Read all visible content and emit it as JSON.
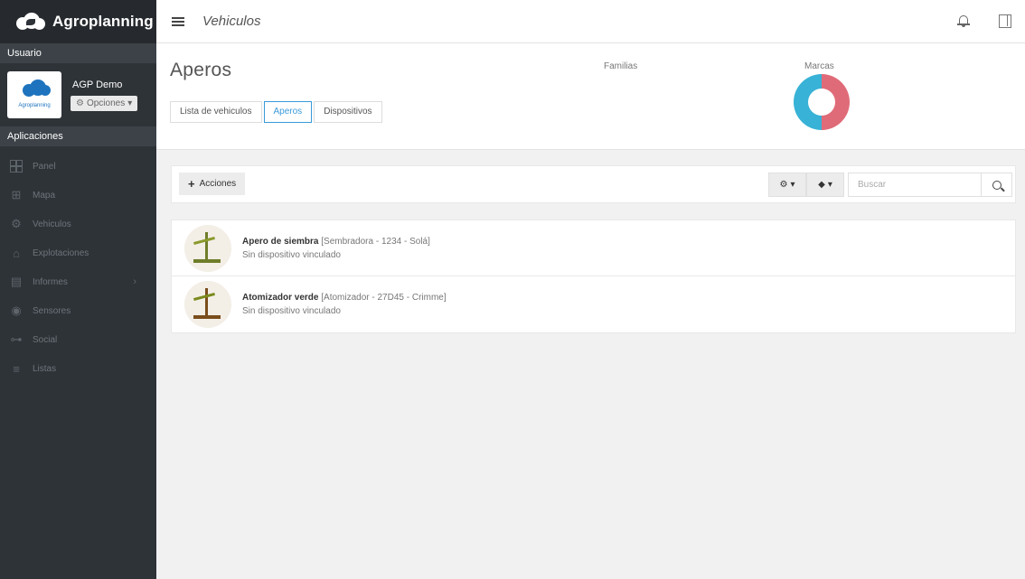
{
  "brand": {
    "name": "Agroplanning"
  },
  "sidebar": {
    "user_section": "Usuario",
    "avatar_label": "Agroplanning",
    "user_name": "AGP Demo",
    "options_label": "Opciones",
    "apps_section": "Aplicaciones",
    "items": [
      {
        "label": "Panel",
        "icon": "dashboard-icon"
      },
      {
        "label": "Mapa",
        "icon": "map-icon"
      },
      {
        "label": "Vehiculos",
        "icon": "vehicles-icon"
      },
      {
        "label": "Explotaciones",
        "icon": "farm-icon"
      },
      {
        "label": "Informes",
        "icon": "reports-icon"
      },
      {
        "label": "Sensores",
        "icon": "sensor-icon"
      },
      {
        "label": "Social",
        "icon": "social-icon"
      },
      {
        "label": "Listas",
        "icon": "list-icon"
      }
    ]
  },
  "topbar": {
    "title": "Vehiculos"
  },
  "header": {
    "title": "Aperos",
    "tabs": [
      {
        "label": "Lista de vehiculos"
      },
      {
        "label": "Aperos"
      },
      {
        "label": "Dispositivos"
      }
    ],
    "families_label": "Familias",
    "brands_label": "Marcas",
    "brands_chart_colors": [
      "#e06b78",
      "#38b2d6"
    ]
  },
  "toolbar": {
    "actions_label": "Acciones",
    "search_placeholder": "Buscar"
  },
  "list": {
    "items": [
      {
        "name": "Apero de siembra",
        "details": "[Sembradora - 1234 - Solá]",
        "status": "Sin dispositivo vinculado"
      },
      {
        "name": "Atomizador verde",
        "details": "[Atomizador - 27D45 - Crimme]",
        "status": "Sin dispositivo vinculado"
      }
    ]
  },
  "colors": {
    "accent": "#3a9ad9",
    "sidebar": "#2e3338"
  }
}
